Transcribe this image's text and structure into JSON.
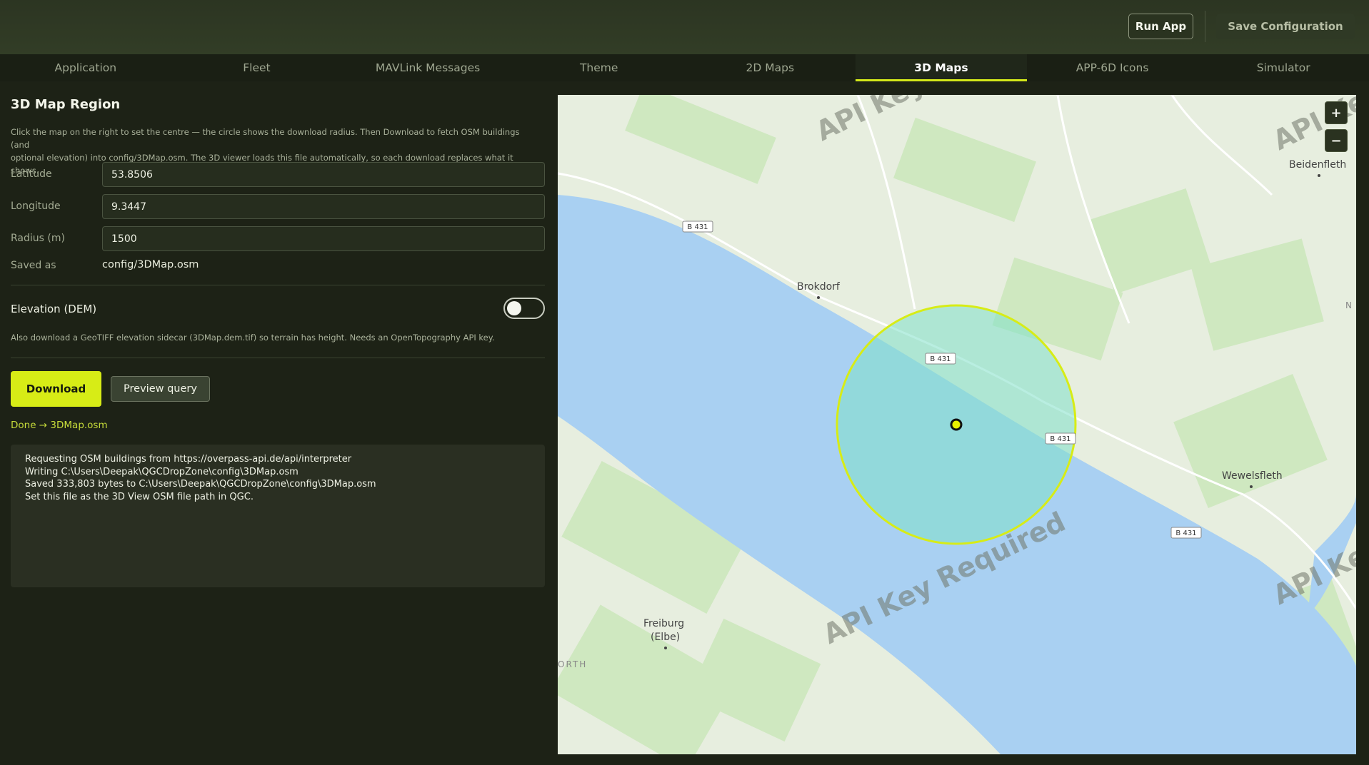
{
  "toolbar": {
    "run_label": "Run App",
    "save_label": "Save Configuration"
  },
  "tabs": [
    {
      "label": "Application"
    },
    {
      "label": "Fleet"
    },
    {
      "label": "MAVLink Messages"
    },
    {
      "label": "Theme"
    },
    {
      "label": "2D Maps"
    },
    {
      "label": "3D Maps",
      "active": true
    },
    {
      "label": "APP-6D Icons"
    },
    {
      "label": "Simulator"
    }
  ],
  "panel": {
    "title": "3D Map Region",
    "description_line1": "Click the map on the right to set the centre — the circle shows the download radius. Then Download to fetch OSM buildings (and",
    "description_line2": "optional elevation) into config/3DMap.osm. The 3D viewer loads this file automatically, so each download replaces what it shows.",
    "latitude_label": "Latitude",
    "latitude_value": "53.8506",
    "longitude_label": "Longitude",
    "longitude_value": "9.3447",
    "radius_label": "Radius (m)",
    "radius_value": "1500",
    "saved_label": "Saved as",
    "saved_value": "config/3DMap.osm",
    "elevation_label": "Elevation (DEM)",
    "elevation_enabled": false,
    "elevation_desc": "Also download a GeoTIFF elevation sidecar (3DMap.dem.tif) so terrain has height. Needs an OpenTopography API key.",
    "download_label": "Download",
    "preview_label": "Preview query",
    "status": "Done → 3DMap.osm",
    "log": [
      "Requesting OSM buildings from https://overpass-api.de/api/interpreter",
      "Writing C:\\Users\\Deepak\\QGCDropZone\\config\\3DMap.osm",
      "Saved 333,803 bytes to C:\\Users\\Deepak\\QGCDropZone\\config\\3DMap.osm",
      "Set this file as the 3D View OSM file path in QGC."
    ]
  },
  "map": {
    "watermark": "API Key Required",
    "zoom_in": "+",
    "zoom_out": "−",
    "places": {
      "brokdorf": "Brokdorf",
      "beidenfleth": "Beidenfleth",
      "wewelsfleth": "Wewelsfleth",
      "freiburg1": "Freiburg",
      "freiburg2": "(Elbe)",
      "worth": "ORTH",
      "n_edge": "N"
    },
    "road_label": "B 431",
    "colors": {
      "water": "#a9d0f2",
      "land": "#e7eedf",
      "field": "#cfe8c0",
      "circle_fill": "#7fe0c9",
      "circle_stroke": "#d7ec16"
    }
  }
}
